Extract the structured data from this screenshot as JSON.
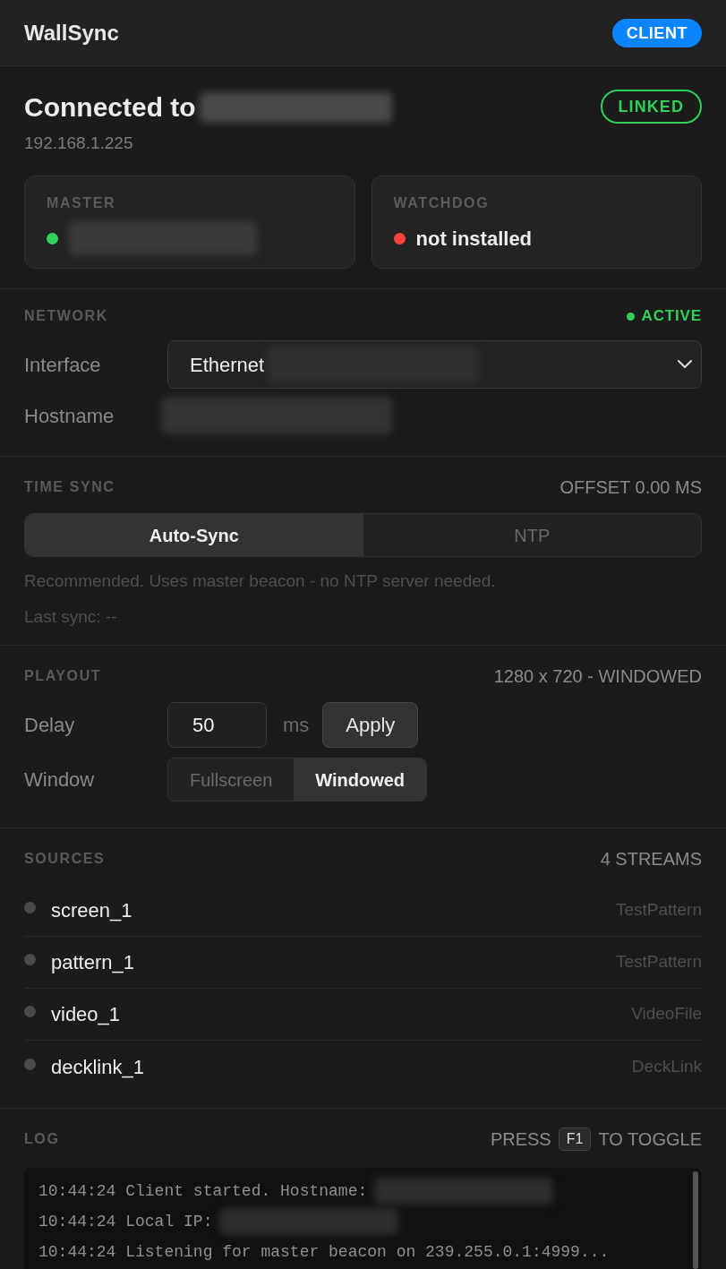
{
  "app": {
    "title": "WallSync",
    "role_badge": "CLIENT"
  },
  "connection": {
    "heading": "Connected to",
    "heading_redacted": true,
    "address": "192.168.1.225",
    "status": "LINKED",
    "cards": [
      {
        "label": "MASTER",
        "color": "#30d158",
        "redacted": true
      },
      {
        "label": "WATCHDOG",
        "color": "#ff453a",
        "value": "not installed",
        "redacted": false
      }
    ]
  },
  "network": {
    "title": "NETWORK",
    "status": "ACTIVE",
    "fields": [
      {
        "kind": "select",
        "label": "Interface",
        "value": "Ethernet",
        "redacted": true
      },
      {
        "kind": "text",
        "label": "Hostname",
        "redacted": true
      }
    ]
  },
  "time_sync": {
    "title": "TIME SYNC",
    "offset": "OFFSET 0.00 MS",
    "modes": [
      {
        "label": "Auto-Sync",
        "selected": true
      },
      {
        "label": "NTP",
        "selected": false
      }
    ],
    "note": "Recommended. Uses master beacon - no NTP server needed.",
    "last_sync": "Last sync: --"
  },
  "playout": {
    "title": "PLAYOUT",
    "summary": "1280 x 720 - WINDOWED",
    "delay": {
      "label": "Delay",
      "value": "50",
      "unit": "ms",
      "button": "Apply"
    },
    "window": {
      "label": "Window",
      "options": [
        {
          "label": "Fullscreen",
          "selected": false
        },
        {
          "label": "Windowed",
          "selected": true
        }
      ]
    }
  },
  "sources": {
    "title": "SOURCES",
    "count": "4 STREAMS",
    "items": [
      {
        "name": "screen_1",
        "type": "TestPattern",
        "active": false
      },
      {
        "name": "pattern_1",
        "type": "TestPattern",
        "active": false
      },
      {
        "name": "video_1",
        "type": "VideoFile",
        "active": false
      },
      {
        "name": "decklink_1",
        "type": "DeckLink",
        "active": false
      }
    ]
  },
  "log": {
    "title": "LOG",
    "hint_before": "PRESS",
    "key": "F1",
    "hint_after": "TO TOGGLE",
    "lines": [
      {
        "text": "10:44:24 Client started. Hostname:",
        "redacted": true
      },
      {
        "text": "10:44:24 Local IP:",
        "redacted": true
      },
      {
        "text": "10:44:24 Listening for master beacon on 239.255.0.1:4999...",
        "redacted": false
      }
    ]
  }
}
